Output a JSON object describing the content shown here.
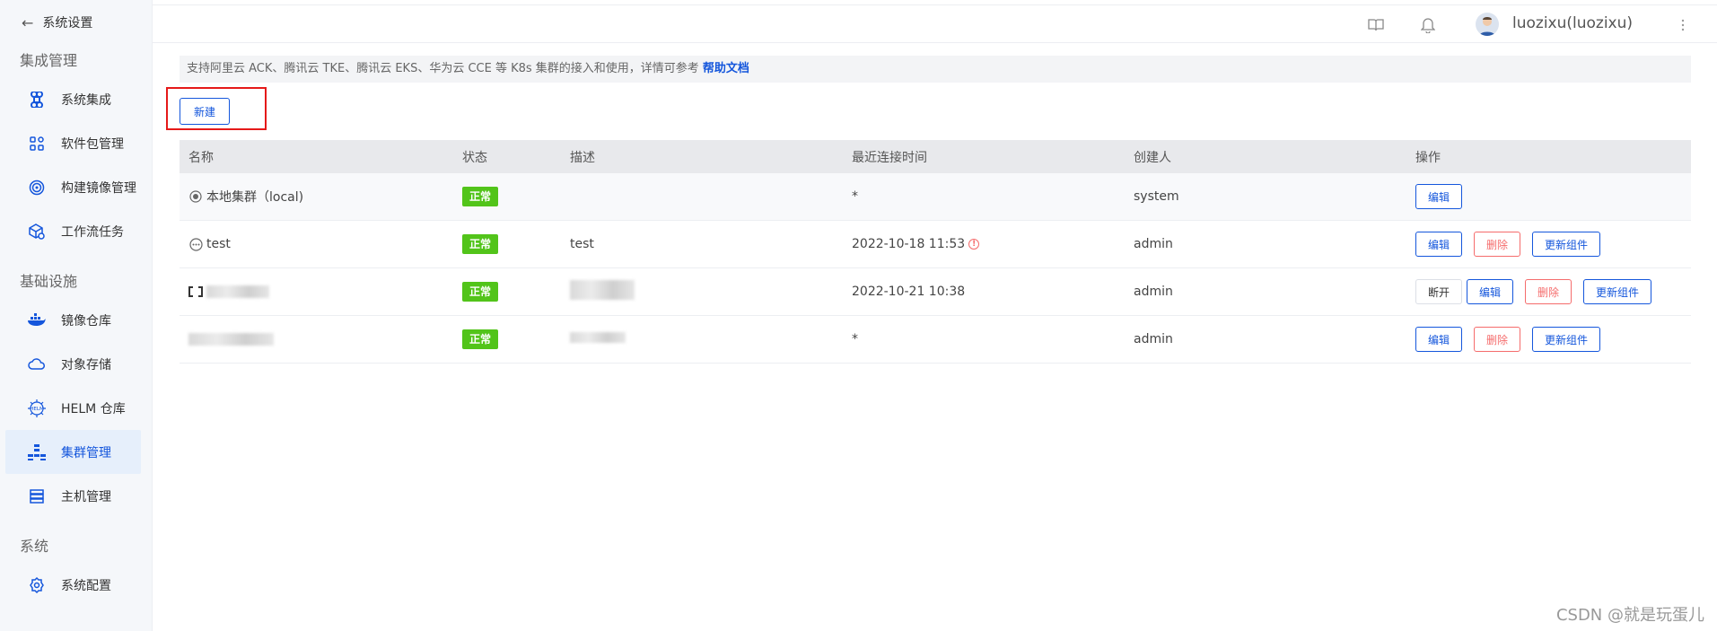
{
  "sidebar": {
    "back_label": "系统设置",
    "groups": [
      {
        "title": "集成管理"
      },
      {
        "title": "基础设施"
      },
      {
        "title": "系统"
      }
    ],
    "items": [
      {
        "label": "系统集成",
        "icon": "command-icon"
      },
      {
        "label": "软件包管理",
        "icon": "grid-icon"
      },
      {
        "label": "构建镜像管理",
        "icon": "target-icon"
      },
      {
        "label": "工作流任务",
        "icon": "cube-gear-icon"
      },
      {
        "label": "镜像仓库",
        "icon": "docker-icon"
      },
      {
        "label": "对象存储",
        "icon": "cloud-icon"
      },
      {
        "label": "HELM 仓库",
        "icon": "helm-icon"
      },
      {
        "label": "集群管理",
        "icon": "cluster-icon",
        "active": true
      },
      {
        "label": "主机管理",
        "icon": "server-icon"
      },
      {
        "label": "系统配置",
        "icon": "gear-icon"
      }
    ]
  },
  "header": {
    "user_name": "luozixu(luozixu)"
  },
  "notice": {
    "text": "支持阿里云 ACK、腾讯云 TKE、腾讯云 EKS、华为云 CCE 等 K8s 集群的接入和使用，详情可参考",
    "link": "帮助文档"
  },
  "new_button": "新建",
  "table": {
    "headers": [
      "名称",
      "状态",
      "描述",
      "最近连接时间",
      "创建人",
      "操作"
    ],
    "rows": [
      {
        "name": "本地集群（local)",
        "status": "正常",
        "desc": "",
        "time": "*",
        "creator": "system"
      },
      {
        "name": "test",
        "status": "正常",
        "desc": "test",
        "time": "2022-10-18 11:53",
        "creator": "admin"
      },
      {
        "name": "",
        "status": "正常",
        "desc": "",
        "time": "2022-10-21 10:38",
        "creator": "admin"
      },
      {
        "name": "",
        "status": "正常",
        "desc": "",
        "time": "*",
        "creator": "admin"
      }
    ],
    "actions": {
      "edit": "编辑",
      "delete": "删除",
      "update": "更新组件",
      "disconnect": "断开"
    }
  },
  "watermark": "CSDN @就是玩蛋儿",
  "colors": {
    "primary": "#1456dc",
    "success": "#52c41a",
    "danger": "#f56c6c",
    "highlight": "#e51919"
  }
}
